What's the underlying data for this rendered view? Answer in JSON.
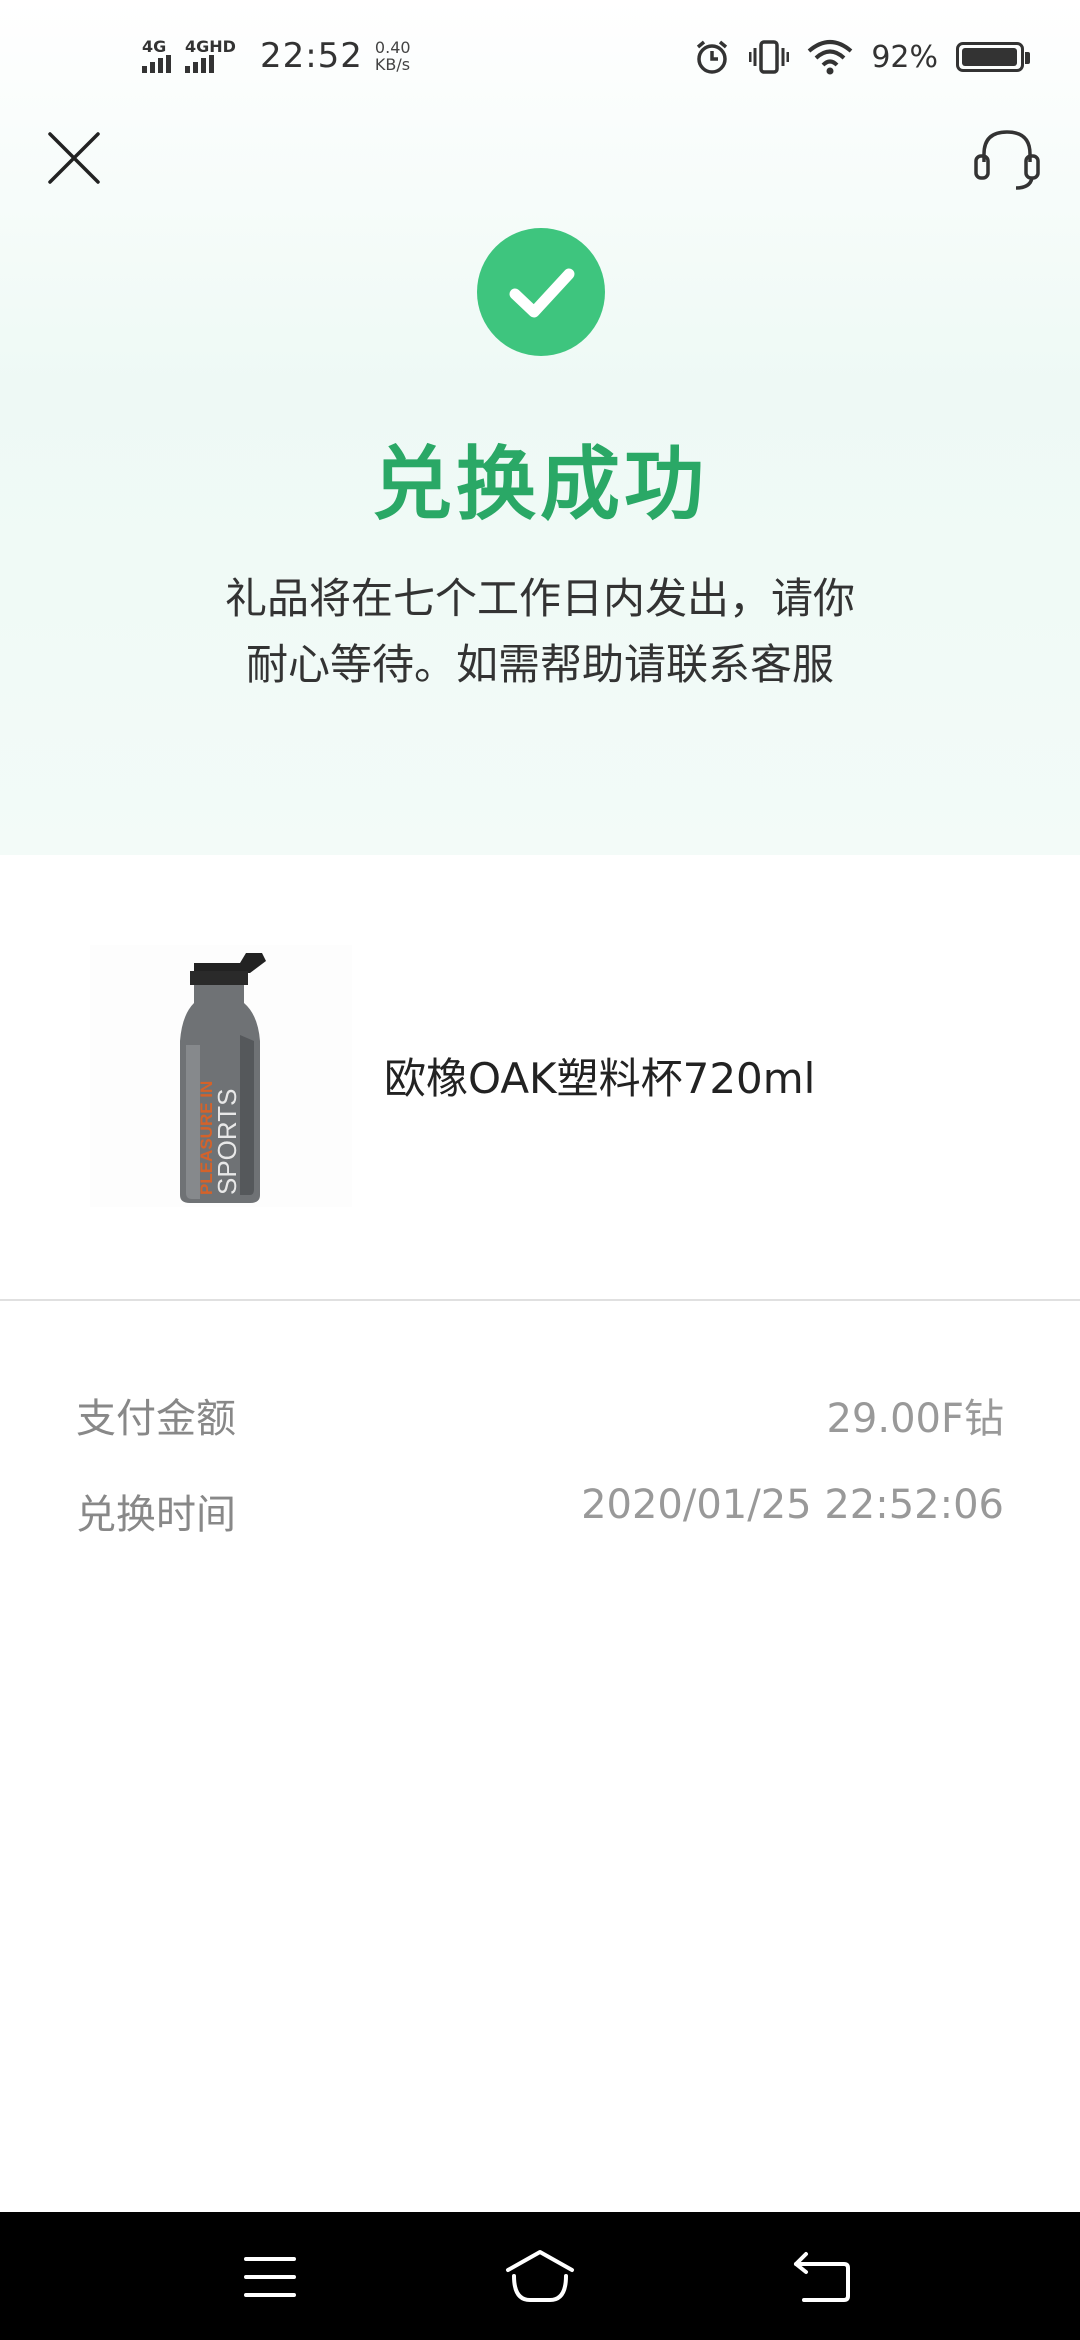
{
  "status_bar": {
    "network1": "4G",
    "network2": "4GHD",
    "time": "22:52",
    "speed_value": "0.40",
    "speed_unit": "KB/s",
    "battery_percent": "92%",
    "icons": [
      "alarm-icon",
      "vibrate-icon",
      "wifi-icon",
      "battery-icon"
    ]
  },
  "header": {
    "close_icon": "close-icon",
    "service_icon": "headset-icon"
  },
  "result": {
    "title": "兑换成功",
    "description": "礼品将在七个工作日内发出，请你耐心等待。如需帮助请联系客服",
    "icon": "check-circle-icon",
    "accent_color": "#3ec57e",
    "title_color": "#2aa866"
  },
  "product": {
    "name": "欧橡OAK塑料杯720ml",
    "image_text_1": "PLEASURE IN",
    "image_text_2": "SPORTS"
  },
  "details": {
    "amount_label": "支付金额",
    "amount_value": "29.00F钻",
    "time_label": "兑换时间",
    "time_value": "2020/01/25 22:52:06"
  },
  "nav_bar": {
    "icons": [
      "menu-icon",
      "home-icon",
      "back-icon"
    ]
  }
}
